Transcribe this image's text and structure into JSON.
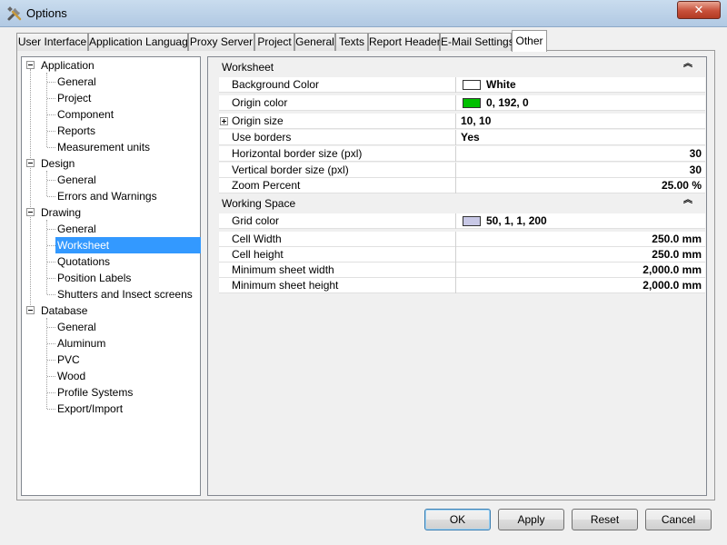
{
  "window": {
    "title": "Options",
    "close_glyph": "✕",
    "icon": "tools-icon"
  },
  "tabs": [
    {
      "label": "User Interface",
      "active": false
    },
    {
      "label": "Application Language",
      "active": false
    },
    {
      "label": "Proxy Server",
      "active": false
    },
    {
      "label": "Project",
      "active": false
    },
    {
      "label": "General",
      "active": false
    },
    {
      "label": "Texts",
      "active": false
    },
    {
      "label": "Report Header",
      "active": false
    },
    {
      "label": "E-Mail Settings",
      "active": false
    },
    {
      "label": "Other",
      "active": true
    }
  ],
  "tree": {
    "application": {
      "label": "Application",
      "children": [
        "General",
        "Project",
        "Component",
        "Reports",
        "Measurement units"
      ]
    },
    "design": {
      "label": "Design",
      "children": [
        "General",
        "Errors and Warnings"
      ]
    },
    "drawing": {
      "label": "Drawing",
      "children": [
        "General",
        "Worksheet",
        "Quotations",
        "Position Labels",
        "Shutters and Insect screens"
      ],
      "selected": "Worksheet"
    },
    "database": {
      "label": "Database",
      "children": [
        "General",
        "Aluminum",
        "PVC",
        "Wood",
        "Profile Systems",
        "Export/Import"
      ]
    }
  },
  "grid": {
    "worksheet": {
      "label": "Worksheet",
      "collapse_glyph": "︽",
      "properties": [
        {
          "name": "Background Color",
          "value": "White",
          "swatch": "#ffffff"
        },
        {
          "name": "Origin color",
          "value": "0, 192, 0",
          "swatch": "#00c000"
        },
        {
          "name": "Origin size",
          "value": "10, 10",
          "expandable": true
        },
        {
          "name": "Use borders",
          "value": "Yes"
        },
        {
          "name": "Horizontal border size (pxl)",
          "value": "30",
          "align": "right"
        },
        {
          "name": "Vertical border size (pxl)",
          "value": "30",
          "align": "right"
        },
        {
          "name": "Zoom Percent",
          "value": "25.00 %",
          "align": "right"
        }
      ]
    },
    "working_space": {
      "label": "Working Space",
      "collapse_glyph": "︽",
      "properties": [
        {
          "name": "Grid color",
          "value": "50, 1, 1, 200",
          "swatch": "#c8c8e6"
        },
        {
          "name": "Cell Width",
          "value": "250.0 mm",
          "align": "right"
        },
        {
          "name": "Cell height",
          "value": "250.0 mm",
          "align": "right"
        },
        {
          "name": "Minimum sheet width",
          "value": "2,000.0 mm",
          "align": "right"
        },
        {
          "name": "Minimum sheet height",
          "value": "2,000.0 mm",
          "align": "right"
        }
      ]
    }
  },
  "buttons": {
    "ok": "OK",
    "apply": "Apply",
    "reset": "Reset",
    "cancel": "Cancel"
  }
}
